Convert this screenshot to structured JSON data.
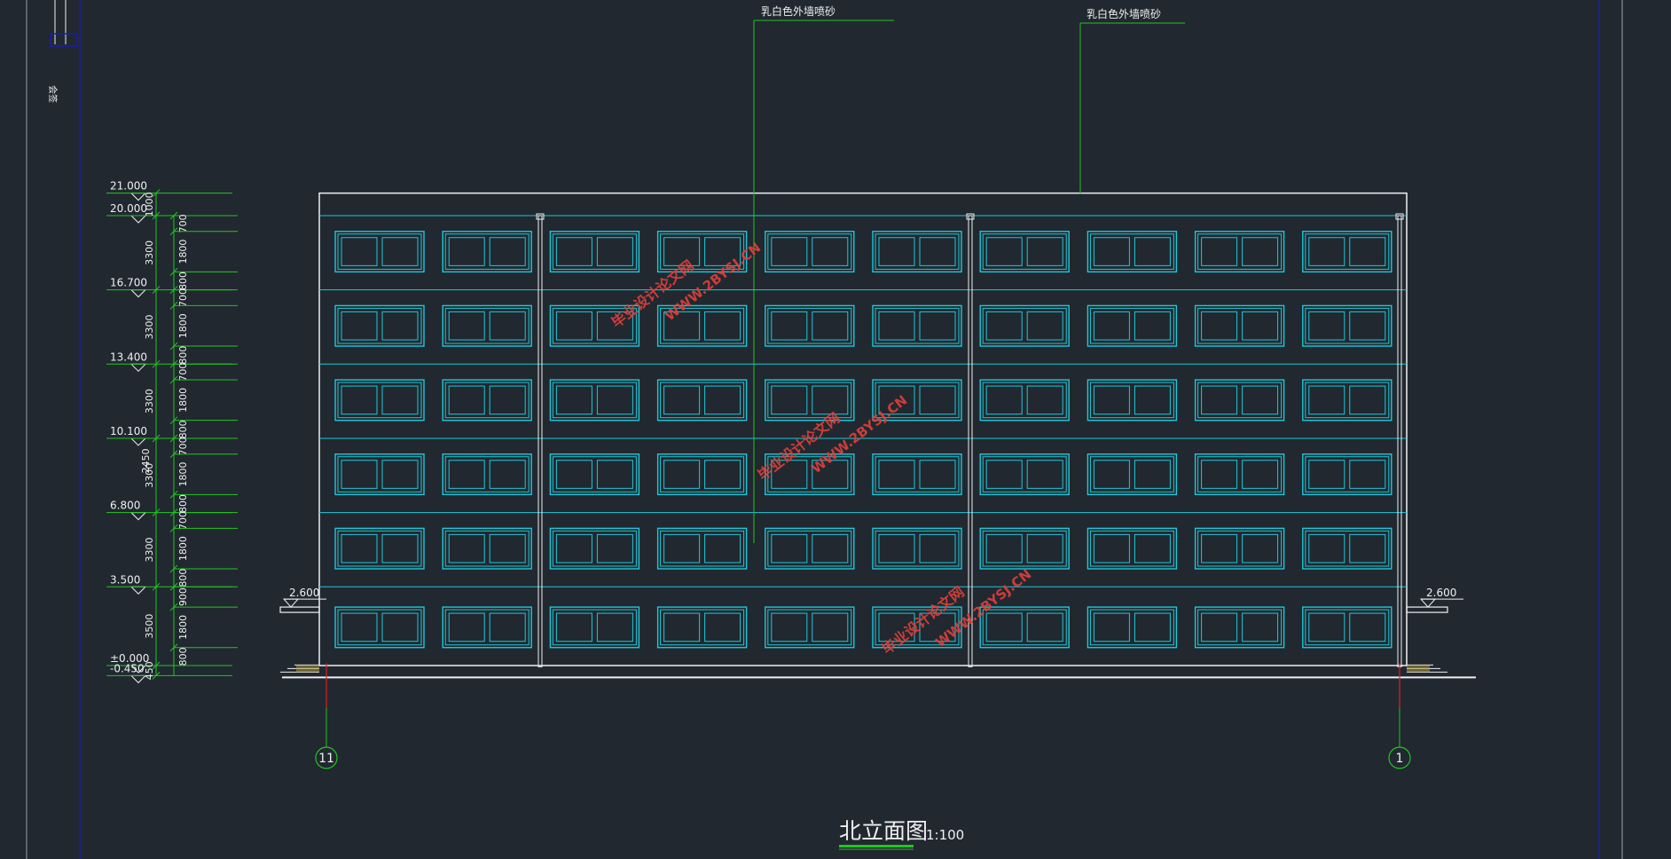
{
  "drawing": {
    "title": "北立面图",
    "scale": "1:100",
    "side_label": "会签",
    "finish_notes": [
      "乳白色外墙喷砂",
      "乳白色外墙喷砂"
    ],
    "grid_axes": {
      "left": "11",
      "right": "1"
    },
    "canopy_elevations": {
      "left": "2.600",
      "right": "2.600"
    },
    "elevation_marks": [
      {
        "label": "21.000",
        "value": 21.0
      },
      {
        "label": "20.000",
        "value": 20.0
      },
      {
        "label": "16.700",
        "value": 16.7
      },
      {
        "label": "13.400",
        "value": 13.4
      },
      {
        "label": "10.100",
        "value": 10.1
      },
      {
        "label": "6.800",
        "value": 6.8
      },
      {
        "label": "3.500",
        "value": 3.5
      },
      {
        "label": "±0.000",
        "value": 0.0
      },
      {
        "label": "-0.450",
        "value": -0.45
      }
    ],
    "dims_outer": [
      "1000",
      "3300",
      "3300",
      "3300",
      "3300",
      "3300",
      "3500",
      "450"
    ],
    "dims_inner": [
      "700",
      "1800",
      "800",
      "700",
      "1800",
      "800",
      "700",
      "1800",
      "800",
      "700",
      "1800",
      "800",
      "700",
      "1800",
      "800",
      "900",
      "1800",
      "800"
    ],
    "dims_misc": [
      "2450"
    ],
    "watermarks": [
      {
        "text": "毕业设计论文网",
        "url": "WWW.2BYSJ.CN"
      },
      {
        "text": "毕业设计论文网",
        "url": "WWW.2BYSJ.CN"
      },
      {
        "text": "毕业设计论文网",
        "url": "WWW.2BYSJ.CN"
      }
    ],
    "facade": {
      "floors": 6,
      "windows_per_floor": 10
    },
    "colors": {
      "background": "#212830",
      "outline": "#f0f0f0",
      "window": "#1ec8d8",
      "dimension": "#22c522",
      "axis": "#e02020",
      "watermark": "#e0403a",
      "frame": "#1c1ca8"
    }
  }
}
